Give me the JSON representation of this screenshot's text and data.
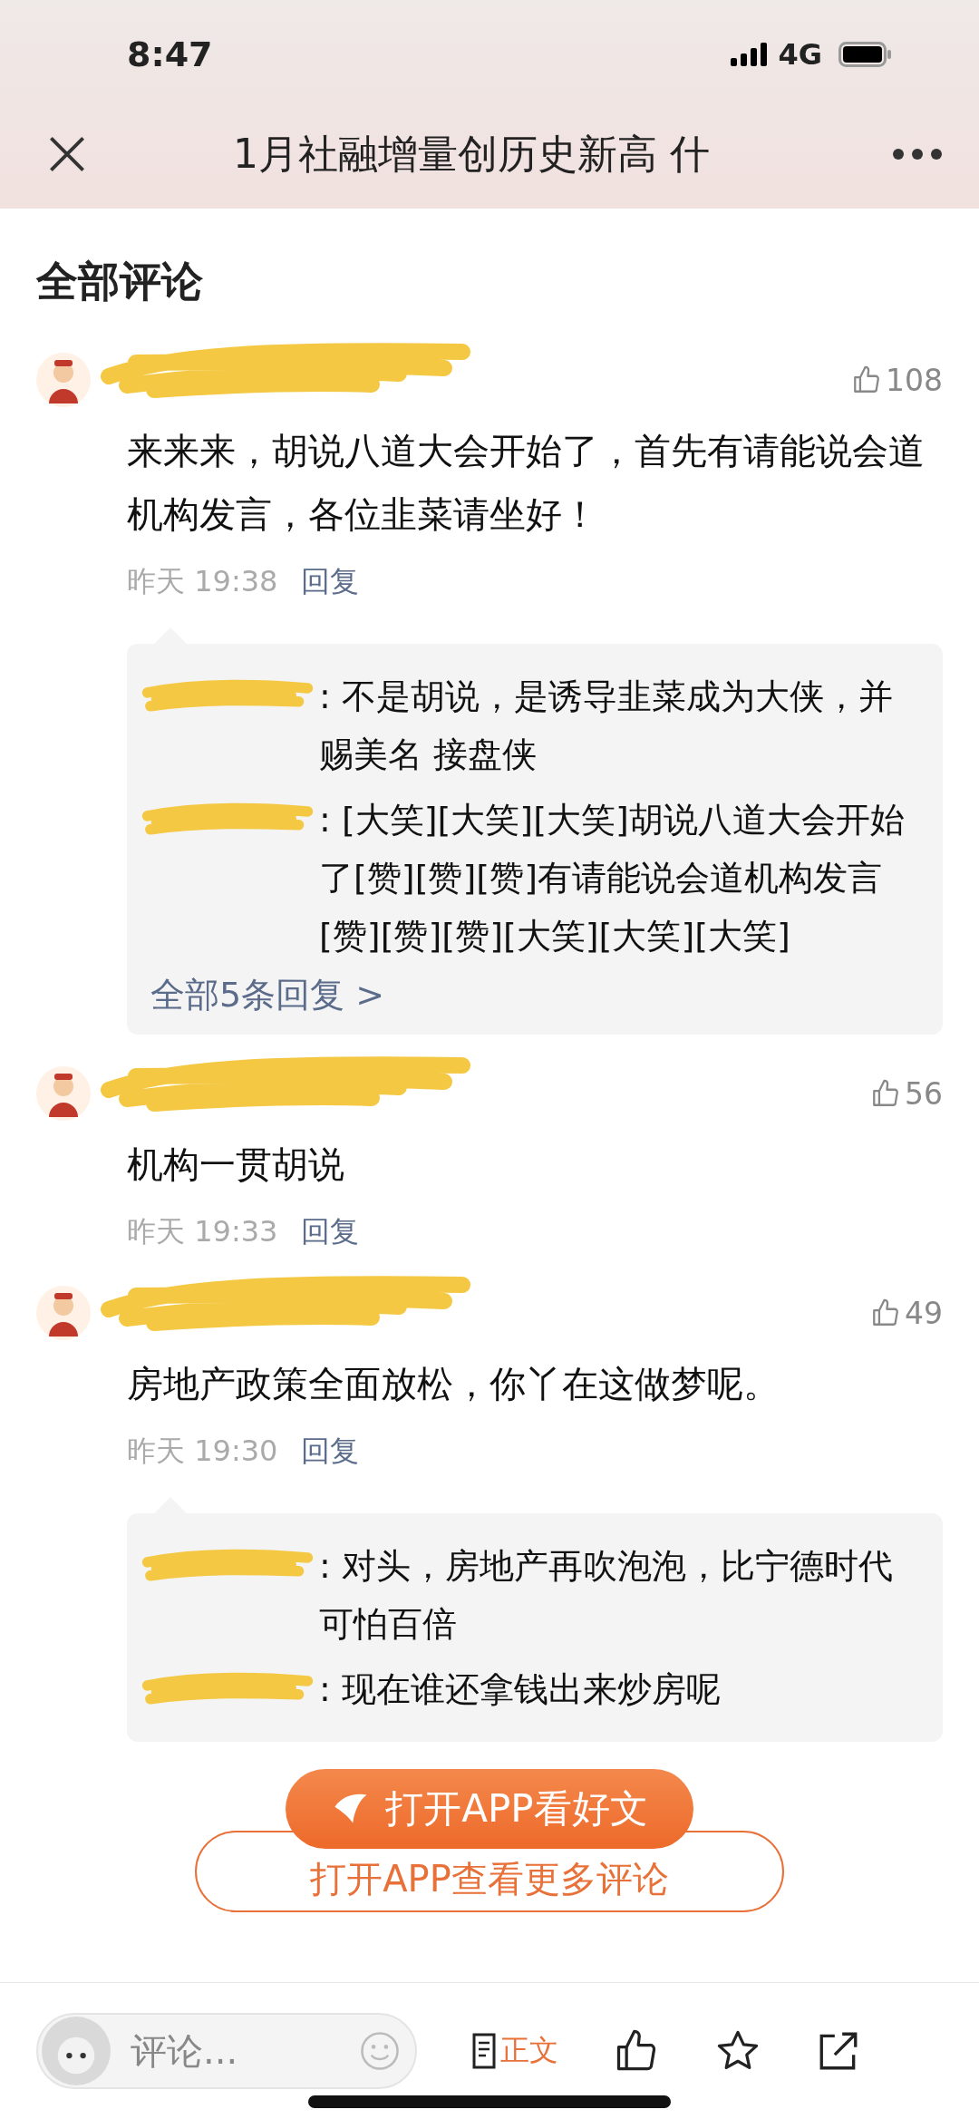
{
  "status_bar": {
    "time": "8:47",
    "network": "4G"
  },
  "nav": {
    "title": "1月社融增量创历史新高 什"
  },
  "section_title": "全部评论",
  "comments": [
    {
      "likes": "108",
      "text": "来来来，胡说八道大会开始了，首先有请能说会道机构发言，各位韭菜请坐好！",
      "time": "昨天 19:38",
      "reply_label": "回复",
      "replies": [
        {
          "text": ": 不是胡说，是诱导韭菜成为大侠，并赐美名 接盘侠"
        },
        {
          "text": ": [大笑][大笑][大笑]胡说八道大会开始了[赞][赞][赞]有请能说会道机构发言[赞][赞][赞][大笑][大笑][大笑]"
        }
      ],
      "more_replies": "全部5条回复 >"
    },
    {
      "likes": "56",
      "text": "机构一贯胡说",
      "time": "昨天 19:33",
      "reply_label": "回复"
    },
    {
      "likes": "49",
      "text": "房地产政策全面放松，你丫在这做梦呢。",
      "time": "昨天 19:30",
      "reply_label": "回复",
      "replies": [
        {
          "text": ": 对头，房地产再吹泡泡，比宁德时代可怕百倍"
        },
        {
          "text": ": 现在谁还拿钱出来炒房呢"
        }
      ]
    }
  ],
  "cta": {
    "button": "打开APP看好文",
    "more": "打开APP查看更多评论"
  },
  "bottom_bar": {
    "comment_placeholder": "评论...",
    "article_label": "正文"
  }
}
